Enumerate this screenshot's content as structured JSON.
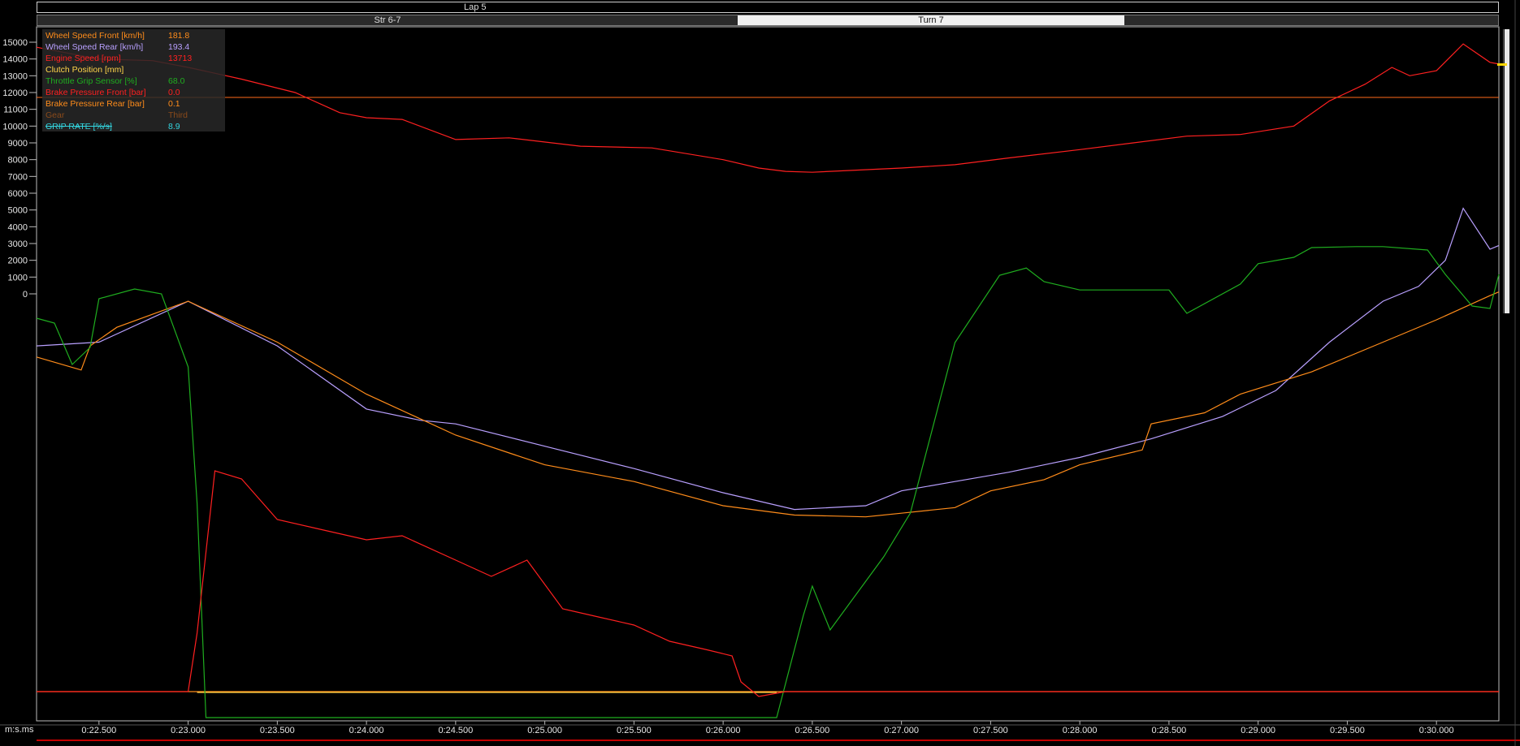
{
  "lap_label": "Lap 5",
  "segments": {
    "previous": "Str 6-7",
    "current": "Turn 7"
  },
  "x_axis_unit_label": "m:s.ms",
  "legend": [
    {
      "name": "Wheel Speed Front [km/h]",
      "value": "181.8",
      "color": "#ff8c1a"
    },
    {
      "name": "Wheel Speed Rear [km/h]",
      "value": "193.4",
      "color": "#b9a0ff"
    },
    {
      "name": "Engine Speed [rpm]",
      "value": "13713",
      "color": "#ff2020"
    },
    {
      "name": "Clutch Position [mm]",
      "value": "",
      "color": "#ffd54a"
    },
    {
      "name": "Throttle Grip Sensor [%]",
      "value": "68.0",
      "color": "#1fae1f"
    },
    {
      "name": "Brake Pressure Front [bar]",
      "value": "0.0",
      "color": "#ff2020"
    },
    {
      "name": "Brake Pressure Rear [bar]",
      "value": "0.1",
      "color": "#ff8c1a"
    },
    {
      "name": "Gear",
      "value": "Third",
      "color": "#8a4a1a"
    },
    {
      "name": "GRIP RATE [%/s]",
      "value": "8.9",
      "color": "#33d6e0"
    }
  ],
  "chart_data": {
    "type": "line",
    "x_ticks": [
      "0:22.500",
      "0:23.000",
      "0:23.500",
      "0:24.000",
      "0:24.500",
      "0:25.000",
      "0:25.500",
      "0:26.000",
      "0:26.500",
      "0:27.000",
      "0:27.500",
      "0:28.000",
      "0:28.500",
      "0:29.000",
      "0:29.500",
      "0:30.000"
    ],
    "x_tick_values": [
      22.5,
      23.0,
      23.5,
      24.0,
      24.5,
      25.0,
      25.5,
      26.0,
      26.5,
      27.0,
      27.5,
      28.0,
      28.5,
      29.0,
      29.5,
      30.0
    ],
    "xlim": [
      22.15,
      30.35
    ],
    "y_ticks": [
      "15000",
      "14000",
      "13000",
      "12000",
      "11000",
      "10000",
      "9000",
      "8000",
      "7000",
      "6000",
      "5000",
      "4000",
      "3000",
      "2000",
      "1000",
      "0"
    ],
    "ylim": [
      0,
      15500
    ],
    "series": [
      {
        "name": "Engine Speed [rpm]",
        "color": "#ff2020",
        "x": [
          22.15,
          22.5,
          22.8,
          23.0,
          23.3,
          23.6,
          23.85,
          24.0,
          24.2,
          24.5,
          24.8,
          25.2,
          25.6,
          26.0,
          26.2,
          26.35,
          26.5,
          26.6,
          27.0,
          27.3,
          27.6,
          28.0,
          28.3,
          28.6,
          28.9,
          29.2,
          29.4,
          29.6,
          29.75,
          29.85,
          30.0,
          30.15,
          30.3,
          30.35
        ],
        "y": [
          14700,
          14000,
          13900,
          13500,
          12800,
          12000,
          10800,
          10500,
          10400,
          9200,
          9300,
          8800,
          8700,
          8000,
          7500,
          7300,
          7250,
          7300,
          7500,
          7700,
          8100,
          8600,
          9000,
          9400,
          9500,
          10000,
          11500,
          12500,
          13500,
          13000,
          13300,
          14900,
          13800,
          13700
        ]
      },
      {
        "name": "Wheel Speed Rear [km/h]",
        "color": "#b9a0ff",
        "x": [
          22.15,
          22.5,
          23.0,
          23.5,
          24.0,
          24.3,
          24.5,
          25.0,
          25.5,
          26.0,
          26.4,
          26.8,
          27.0,
          27.3,
          27.6,
          28.0,
          28.4,
          28.8,
          29.1,
          29.4,
          29.7,
          29.9,
          30.05,
          30.15,
          30.3,
          30.35
        ],
        "y": [
          186,
          188,
          210,
          186,
          152,
          146,
          144,
          132,
          120,
          107,
          98,
          100,
          108,
          113,
          118,
          126,
          136,
          148,
          162,
          188,
          210,
          218,
          232,
          260,
          238,
          240
        ]
      },
      {
        "name": "Wheel Speed Front [km/h]",
        "color": "#ff8c1a",
        "x": [
          22.15,
          22.4,
          22.45,
          22.6,
          23.0,
          23.5,
          24.0,
          24.5,
          25.0,
          25.5,
          26.0,
          26.4,
          26.8,
          27.0,
          27.3,
          27.5,
          27.8,
          28.0,
          28.35,
          28.4,
          28.7,
          28.9,
          29.3,
          29.7,
          30.0,
          30.3,
          30.35
        ],
        "y": [
          180,
          173,
          186,
          196,
          210,
          188,
          160,
          138,
          122,
          113,
          100,
          95,
          94,
          96,
          99,
          108,
          114,
          122,
          130,
          144,
          150,
          160,
          172,
          188,
          200,
          213,
          215
        ]
      },
      {
        "name": "Throttle Grip Sensor [%]",
        "color": "#1fae1f",
        "x": [
          22.15,
          22.25,
          22.35,
          22.45,
          22.5,
          22.7,
          22.85,
          23.0,
          23.05,
          23.1,
          23.2,
          26.3,
          26.45,
          26.5,
          26.6,
          26.9,
          27.05,
          27.3,
          27.55,
          27.7,
          27.8,
          28.0,
          28.5,
          28.6,
          28.9,
          29.0,
          29.2,
          29.3,
          29.55,
          29.7,
          29.95,
          30.05,
          30.2,
          30.3,
          30.35
        ],
        "y": [
          -50,
          -60,
          -145,
          -110,
          -10,
          10,
          0,
          -150,
          -430,
          -870,
          -870,
          -870,
          -660,
          -600,
          -690,
          -540,
          -450,
          -100,
          38,
          53,
          25,
          8,
          8,
          -40,
          20,
          62,
          75,
          95,
          97,
          97,
          90,
          40,
          -25,
          -30,
          40
        ]
      }
    ],
    "notes_hidden": []
  }
}
